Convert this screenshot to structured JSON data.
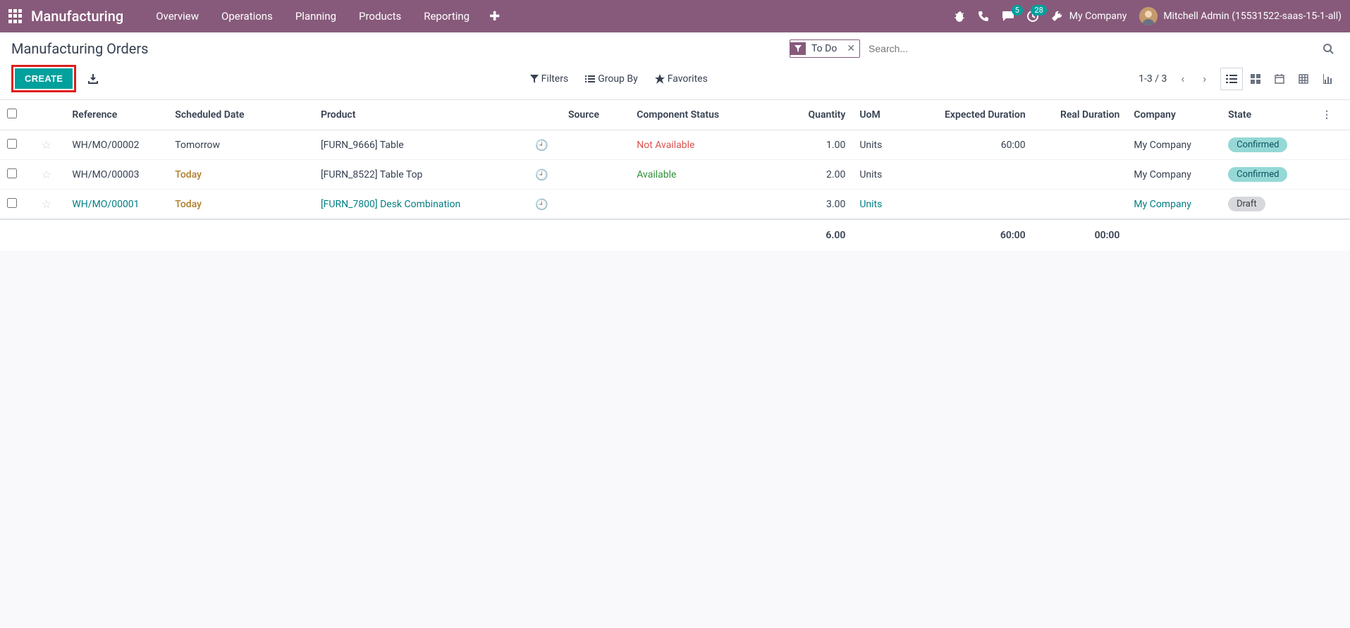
{
  "nav": {
    "brand": "Manufacturing",
    "items": [
      "Overview",
      "Operations",
      "Planning",
      "Products",
      "Reporting"
    ],
    "messages_badge": "5",
    "activities_badge": "28",
    "company": "My Company",
    "user": "Mitchell Admin (15531522-saas-15-1-all)"
  },
  "cp": {
    "title": "Manufacturing Orders",
    "facet_label": "To Do",
    "search_placeholder": "Search...",
    "create_label": "CREATE",
    "filters_label": "Filters",
    "groupby_label": "Group By",
    "favorites_label": "Favorites",
    "pager": "1-3 / 3"
  },
  "columns": {
    "reference": "Reference",
    "scheduled": "Scheduled Date",
    "product": "Product",
    "source": "Source",
    "component": "Component Status",
    "quantity": "Quantity",
    "uom": "UoM",
    "expected": "Expected Duration",
    "real": "Real Duration",
    "company": "Company",
    "state": "State"
  },
  "rows": [
    {
      "reference": "WH/MO/00002",
      "ref_link": false,
      "scheduled": "Tomorrow",
      "scheduled_today": false,
      "product": "[FURN_9666] Table",
      "product_link": false,
      "component": "Not Available",
      "component_class": "na",
      "quantity": "1.00",
      "uom": "Units",
      "uom_link": false,
      "expected": "60:00",
      "real": "",
      "company": "My Company",
      "company_link": false,
      "state": "Confirmed",
      "state_class": "state-confirmed"
    },
    {
      "reference": "WH/MO/00003",
      "ref_link": false,
      "scheduled": "Today",
      "scheduled_today": true,
      "product": "[FURN_8522] Table Top",
      "product_link": false,
      "component": "Available",
      "component_class": "avail",
      "quantity": "2.00",
      "uom": "Units",
      "uom_link": false,
      "expected": "",
      "real": "",
      "company": "My Company",
      "company_link": false,
      "state": "Confirmed",
      "state_class": "state-confirmed"
    },
    {
      "reference": "WH/MO/00001",
      "ref_link": true,
      "scheduled": "Today",
      "scheduled_today": true,
      "product": "[FURN_7800] Desk Combination",
      "product_link": true,
      "component": "",
      "component_class": "",
      "quantity": "3.00",
      "uom": "Units",
      "uom_link": true,
      "expected": "",
      "real": "",
      "company": "My Company",
      "company_link": true,
      "state": "Draft",
      "state_class": "state-draft"
    }
  ],
  "totals": {
    "quantity": "6.00",
    "expected": "60:00",
    "real": "00:00"
  }
}
